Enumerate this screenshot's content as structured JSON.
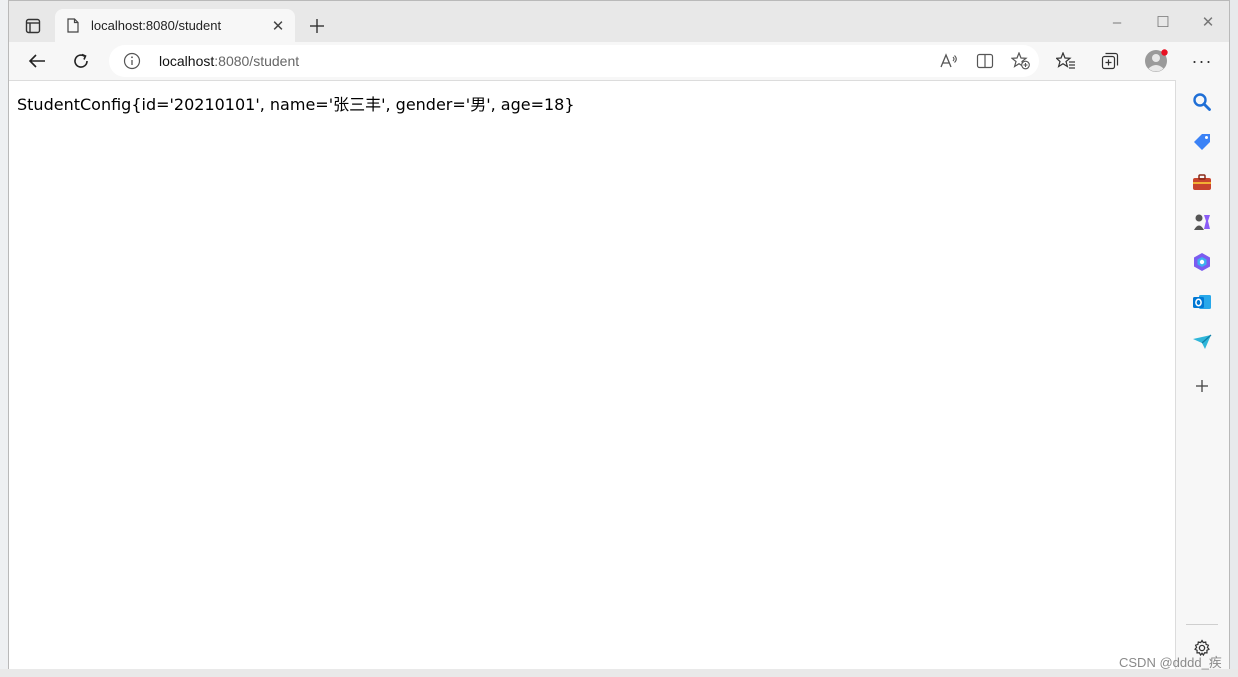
{
  "browser": {
    "tab": {
      "title": "localhost:8080/student"
    },
    "window_controls": {
      "minimize": "–",
      "maximize": "☐",
      "close": "✕"
    },
    "address": {
      "host": "localhost",
      "path": ":8080/student"
    },
    "more_label": "···"
  },
  "page": {
    "text": "StudentConfig{id='20210101', name='张三丰', gender='男', age=18}"
  },
  "sidebar": {
    "items": [
      "search-icon",
      "shopping-tag-icon",
      "tools-briefcase-icon",
      "games-icon",
      "office-icon",
      "outlook-icon",
      "send-icon",
      "add-icon",
      "settings-icon"
    ]
  },
  "colors": {
    "profile_badge": "#e81123",
    "outlook": "#0078d4",
    "tag": "#3b82f6"
  },
  "watermark": "CSDN @dddd_疾"
}
